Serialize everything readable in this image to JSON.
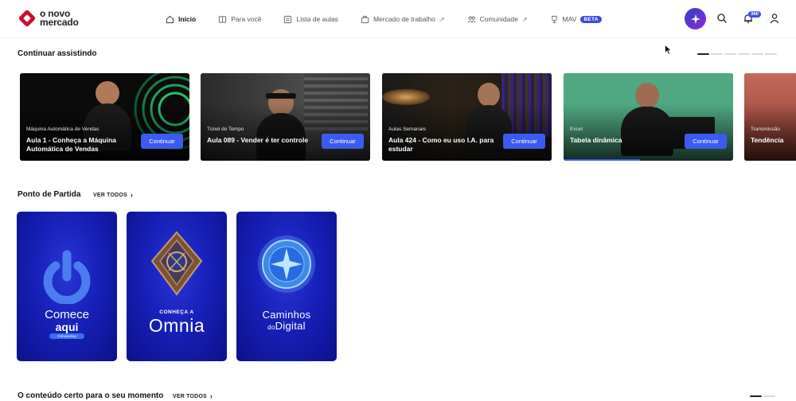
{
  "brand": {
    "name_line1": "o novo",
    "name_line2": "mercado",
    "color": "#c8102e"
  },
  "nav": {
    "items": [
      {
        "label": "Início",
        "icon": "home-icon",
        "active": true
      },
      {
        "label": "Para você",
        "icon": "book-icon"
      },
      {
        "label": "Lista de aulas",
        "icon": "list-icon"
      },
      {
        "label": "Mercado de trabalho",
        "icon": "briefcase-icon",
        "external": "↗"
      },
      {
        "label": "Comunidade",
        "icon": "people-icon",
        "external": "↗"
      },
      {
        "label": "MAV",
        "icon": "trophy-icon",
        "badge": "BETA"
      }
    ]
  },
  "header": {
    "notifications_count": "360"
  },
  "continue_watching": {
    "title": "Continuar assistindo",
    "button_label": "Continuar",
    "cards": [
      {
        "category": "Máquina Automática de Vendas",
        "title": "Aula 1 - Conheça a Máquina Automática de Vendas",
        "progress": 0
      },
      {
        "category": "Túnel do Tempo",
        "title": "Aula 089 - Vender é ter controle",
        "progress": 0
      },
      {
        "category": "Aulas Semanais",
        "title": "Aula 424 - Como eu uso I.A. para estudar",
        "progress": 0
      },
      {
        "category": "Excel",
        "title": "Tabela dinâmica",
        "progress": 0.45
      },
      {
        "category": "Transmissão",
        "title": "Tendência"
      }
    ]
  },
  "starting_point": {
    "title": "Ponto de Partida",
    "see_all": "VER TODOS",
    "posters": [
      {
        "line1": "Comece",
        "line2": "aqui",
        "tag": "Onboarding"
      },
      {
        "line1": "CONHEÇA A",
        "line2": "Omnia"
      },
      {
        "line1": "Caminhos",
        "line2": "do",
        "line3": "Digital"
      }
    ]
  },
  "right_moment": {
    "title": "O conteúdo certo para o seu momento",
    "see_all": "VER TODOS"
  }
}
